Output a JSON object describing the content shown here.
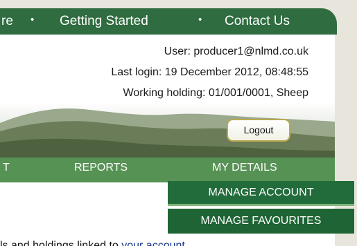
{
  "top_nav": {
    "fragment": "re",
    "items": [
      "Getting Started",
      "Contact Us"
    ],
    "separator": "•"
  },
  "user_info": {
    "user": "User: producer1@nlmd.co.uk",
    "last_login": "Last login: 19 December 2012, 08:48:55",
    "working_holding": "Working holding: 01/001/0001, Sheep"
  },
  "logout_label": "Logout",
  "main_nav": {
    "fragment": "T",
    "reports": "REPORTS",
    "my_details": "MY DETAILS"
  },
  "dropdown": {
    "items": [
      "MANAGE ACCOUNT",
      "MANAGE FAVOURITES"
    ]
  },
  "content": {
    "text_before": "ls and holdings linked to ",
    "link": "your account"
  },
  "colors": {
    "top_nav_bg": "#2f6c3f",
    "main_nav_bg": "#579255",
    "dropdown_bg": "#226b3b",
    "logout_border": "#b9a94e"
  }
}
